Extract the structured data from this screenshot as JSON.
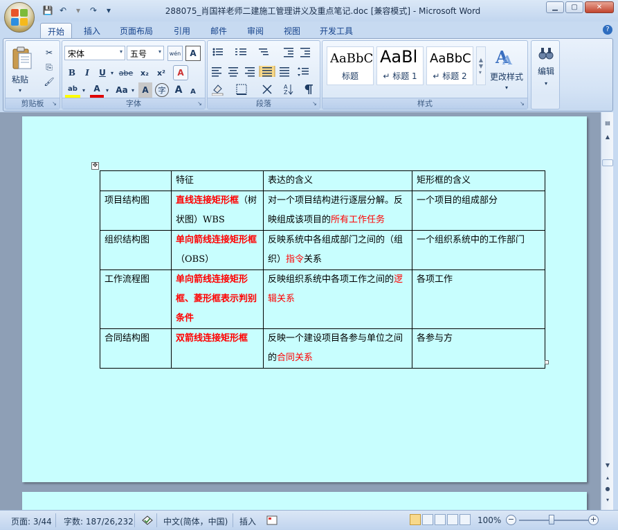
{
  "window": {
    "title": "288075_肖国祥老师二建施工管理讲义及重点笔记.doc [兼容模式] - Microsoft Word",
    "controls": {
      "minimize": "▁",
      "maximize": "▢",
      "close": "✕"
    }
  },
  "quick_access": {
    "save_icon": "💾",
    "undo_icon": "↶",
    "redo_icon": "↷",
    "dropdown_icon": "▾"
  },
  "tabs": [
    "开始",
    "插入",
    "页面布局",
    "引用",
    "邮件",
    "审阅",
    "视图",
    "开发工具"
  ],
  "active_tab": "开始",
  "help_icon": "?",
  "ribbon": {
    "clipboard": {
      "label": "剪贴板",
      "paste_label": "粘贴",
      "cut_icon": "✂",
      "copy_icon": "⎘",
      "format_painter_icon": "🖌"
    },
    "font": {
      "label": "字体",
      "font_name": "宋体",
      "font_size": "五号",
      "wen_icon": "wén",
      "a_icon": "A",
      "bold": "B",
      "italic": "I",
      "underline": "U",
      "strike": "abe",
      "subscript": "x₂",
      "superscript": "x²",
      "clear_format": "A",
      "highlight": "ab",
      "font_color": "A",
      "change_case": "Aa",
      "char_shading": "A",
      "enclose": "字",
      "grow": "A",
      "shrink": "A"
    },
    "paragraph": {
      "label": "段落"
    },
    "styles": {
      "label": "样式",
      "items": [
        {
          "sample": "AaBbC",
          "name": "标题"
        },
        {
          "sample": "AaBl",
          "name": "↵ 标题 1"
        },
        {
          "sample": "AaBbC",
          "name": "↵ 标题 2"
        }
      ],
      "change_styles": "更改样式"
    },
    "editing": {
      "label": "编辑"
    }
  },
  "table": {
    "headers": [
      "",
      "特征",
      "表达的含义",
      "矩形框的含义"
    ],
    "rows": [
      {
        "col1": "项目结构图",
        "col2_red": "直线连接矩形框",
        "col2_plain": "（树状图）WBS",
        "col3_plain": "对一个项目结构进行逐层分解。反映组成该项目的",
        "col3_red": "所有工作任务",
        "col4": "一个项目的组成部分"
      },
      {
        "col1": "组织结构图",
        "col2_red": "单向箭线连接矩形框",
        "col2_plain": "（OBS）",
        "col3_plain": "反映系统中各组成部门之间的（组织）",
        "col3_red": "指令",
        "col3_tail": "关系",
        "col4": "一个组织系统中的工作部门"
      },
      {
        "col1": "工作流程图",
        "col2_red": "单向箭线连接矩形框、菱形框表示判别条件",
        "col3_plain": "反映组织系统中各项工作之间的",
        "col3_red": "逻辑关系",
        "col4": "各项工作"
      },
      {
        "col1": "合同结构图",
        "col2_red": "双箭线连接矩形框",
        "col3_plain": "反映一个建设项目各参与单位之间的",
        "col3_red": "合同关系",
        "col4": "各参与方"
      }
    ]
  },
  "status": {
    "page": "页面: 3/44",
    "words": "字数: 187/26,232",
    "language": "中文(简体，中国)",
    "mode": "插入",
    "zoom": "100%",
    "zoom_minus": "−",
    "zoom_plus": "+"
  }
}
